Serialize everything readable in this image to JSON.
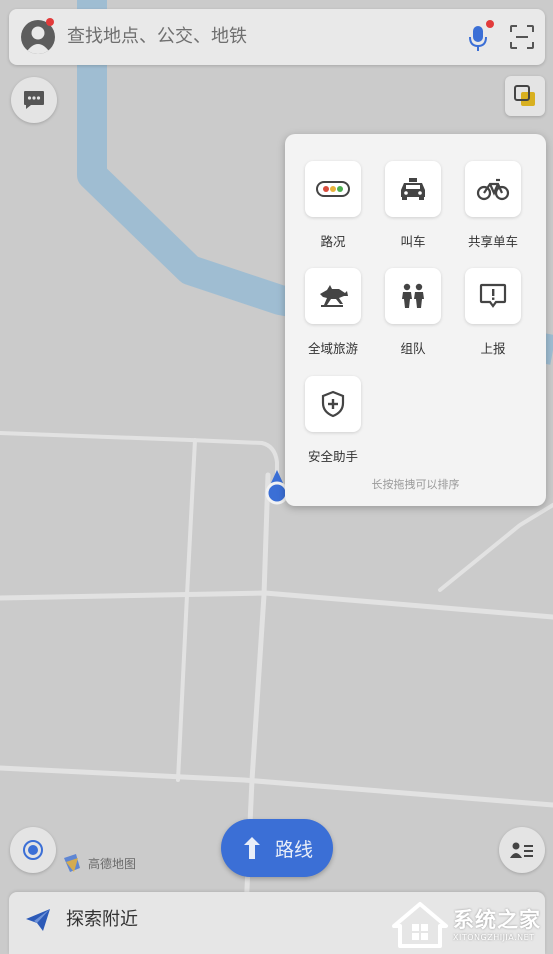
{
  "search": {
    "placeholder_text": "查找地点、公交、地铁"
  },
  "panel": {
    "items": [
      {
        "label": "路况",
        "icon": "traffic-light-icon"
      },
      {
        "label": "叫车",
        "icon": "taxi-icon"
      },
      {
        "label": "共享单车",
        "icon": "bicycle-icon"
      },
      {
        "label": "全域旅游",
        "icon": "horse-icon"
      },
      {
        "label": "组队",
        "icon": "group-icon"
      },
      {
        "label": "上报",
        "icon": "report-icon"
      },
      {
        "label": "安全助手",
        "icon": "shield-plus-icon"
      }
    ],
    "hint": "长按拖拽可以排序"
  },
  "route": {
    "label": "路线"
  },
  "logo": {
    "text": "高德地图"
  },
  "bottom": {
    "label": "探索附近"
  },
  "watermark": {
    "title": "系统之家",
    "url": "XITONGZHIJIA.NET"
  },
  "colors": {
    "accent": "#3b6fd6",
    "river": "#9cbcd2",
    "badge": "#e23b3b",
    "annotation": "#e8342d"
  }
}
